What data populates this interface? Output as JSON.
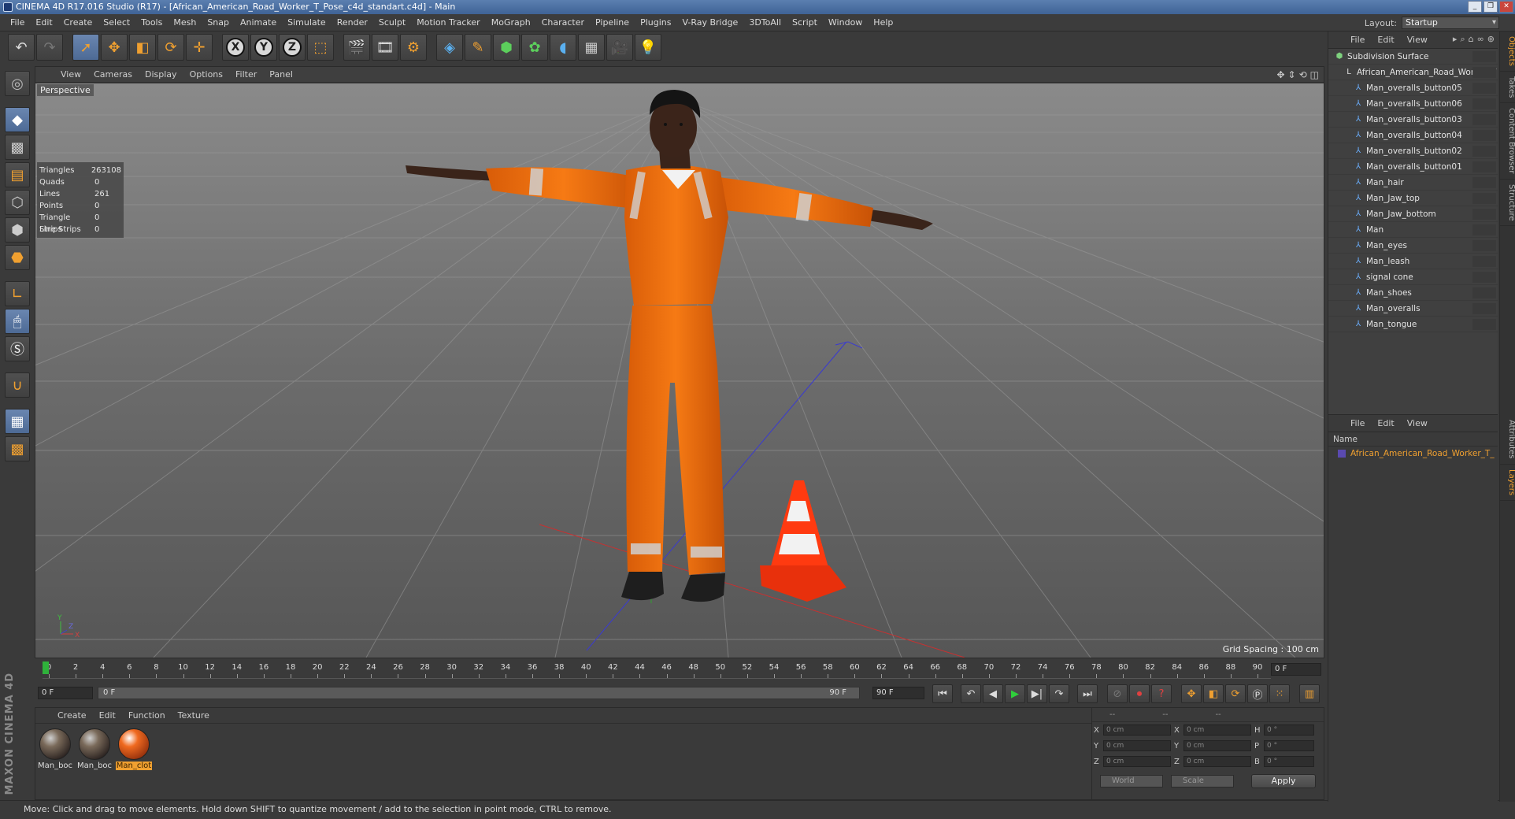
{
  "window": {
    "title": "CINEMA 4D R17.016 Studio (R17) - [African_American_Road_Worker_T_Pose_c4d_standart.c4d] - Main",
    "controls": [
      "_",
      "❐",
      "✕"
    ]
  },
  "menubar": {
    "items": [
      "File",
      "Edit",
      "Create",
      "Select",
      "Tools",
      "Mesh",
      "Snap",
      "Animate",
      "Simulate",
      "Render",
      "Sculpt",
      "Motion Tracker",
      "MoGraph",
      "Character",
      "Pipeline",
      "Plugins",
      "V-Ray Bridge",
      "3DToAll",
      "Script",
      "Window",
      "Help"
    ],
    "layout_label": "Layout:",
    "layout_value": "Startup"
  },
  "toolbar": {
    "axis_x": "X",
    "axis_y": "Y",
    "axis_z": "Z"
  },
  "viewport": {
    "menu": [
      "View",
      "Cameras",
      "Display",
      "Options",
      "Filter",
      "Panel"
    ],
    "label": "Perspective",
    "stats": [
      {
        "label": "Triangles",
        "value": "263108"
      },
      {
        "label": "Quads",
        "value": "0"
      },
      {
        "label": "Lines",
        "value": "261"
      },
      {
        "label": "Points",
        "value": "0"
      },
      {
        "label": "Triangle Strips",
        "value": "0"
      },
      {
        "label": "Line Strips",
        "value": "0"
      }
    ],
    "grid_spacing": "Grid Spacing : 100 cm"
  },
  "timeline": {
    "ticks": [
      "0",
      "2",
      "4",
      "6",
      "8",
      "10",
      "12",
      "14",
      "16",
      "18",
      "20",
      "22",
      "24",
      "26",
      "28",
      "30",
      "32",
      "34",
      "36",
      "38",
      "40",
      "42",
      "44",
      "46",
      "48",
      "50",
      "52",
      "54",
      "56",
      "58",
      "60",
      "62",
      "64",
      "66",
      "68",
      "70",
      "72",
      "74",
      "76",
      "78",
      "80",
      "82",
      "84",
      "86",
      "88",
      "90"
    ],
    "current_frame": "0 F"
  },
  "transport": {
    "start_field": "0 F",
    "range_start": "0 F",
    "range_end": "90 F",
    "end_field": "90 F"
  },
  "materials": {
    "menu": [
      "Create",
      "Edit",
      "Function",
      "Texture"
    ],
    "items": [
      {
        "name": "Man_boc",
        "selected": false
      },
      {
        "name": "Man_boc",
        "selected": false
      },
      {
        "name": "Man_clot",
        "selected": true
      }
    ]
  },
  "coordinates": {
    "header": [
      "--",
      "--",
      "--"
    ],
    "rows": [
      {
        "a": "X",
        "av": "0 cm",
        "b": "X",
        "bv": "0 cm",
        "c": "H",
        "cv": "0 °"
      },
      {
        "a": "Y",
        "av": "0 cm",
        "b": "Y",
        "bv": "0 cm",
        "c": "P",
        "cv": "0 °"
      },
      {
        "a": "Z",
        "av": "0 cm",
        "b": "Z",
        "bv": "0 cm",
        "c": "B",
        "cv": "0 °"
      }
    ],
    "mode": "World",
    "scale": "Scale",
    "apply": "Apply"
  },
  "status": {
    "text": "Move: Click and drag to move elements. Hold down SHIFT to quantize movement / add to the selection in point mode, CTRL to remove."
  },
  "object_manager": {
    "menu": [
      "File",
      "Edit",
      "View"
    ],
    "objects": [
      {
        "name": "Subdivision Surface",
        "indent": 0,
        "icon": "subd"
      },
      {
        "name": "African_American_Road_Worker_T",
        "indent": 1,
        "icon": "null"
      },
      {
        "name": "Man_overalls_button05",
        "indent": 2,
        "icon": "bone"
      },
      {
        "name": "Man_overalls_button06",
        "indent": 2,
        "icon": "bone"
      },
      {
        "name": "Man_overalls_button03",
        "indent": 2,
        "icon": "bone"
      },
      {
        "name": "Man_overalls_button04",
        "indent": 2,
        "icon": "bone"
      },
      {
        "name": "Man_overalls_button02",
        "indent": 2,
        "icon": "bone"
      },
      {
        "name": "Man_overalls_button01",
        "indent": 2,
        "icon": "bone"
      },
      {
        "name": "Man_hair",
        "indent": 2,
        "icon": "bone"
      },
      {
        "name": "Man_Jaw_top",
        "indent": 2,
        "icon": "bone"
      },
      {
        "name": "Man_Jaw_bottom",
        "indent": 2,
        "icon": "bone"
      },
      {
        "name": "Man",
        "indent": 2,
        "icon": "bone"
      },
      {
        "name": "Man_eyes",
        "indent": 2,
        "icon": "bone"
      },
      {
        "name": "Man_leash",
        "indent": 2,
        "icon": "bone"
      },
      {
        "name": "signal cone",
        "indent": 2,
        "icon": "bone"
      },
      {
        "name": "Man_shoes",
        "indent": 2,
        "icon": "bone"
      },
      {
        "name": "Man_overalls",
        "indent": 2,
        "icon": "bone"
      },
      {
        "name": "Man_tongue",
        "indent": 2,
        "icon": "bone"
      }
    ]
  },
  "layer_manager": {
    "menu": [
      "File",
      "Edit",
      "View"
    ],
    "column": "Name",
    "rows": [
      "African_American_Road_Worker_T_"
    ]
  },
  "side_tabs": {
    "top": [
      "Objects",
      "Takes",
      "Content Browser",
      "Structure"
    ],
    "bottom": [
      "Attributes",
      "Layers"
    ]
  },
  "branding": "MAXON CINEMA 4D",
  "colors": {
    "accent": "#f0a030",
    "overalls": "#f2740f",
    "cone": "#ff3a10",
    "play": "#2fcf3b"
  }
}
